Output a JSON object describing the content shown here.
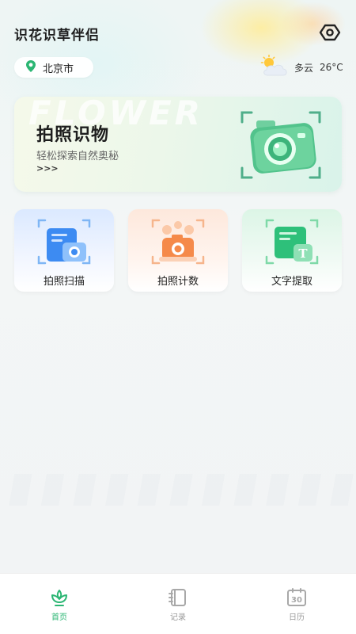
{
  "header": {
    "title": "识花识草伴侣",
    "settings_icon": "eye-icon"
  },
  "location": {
    "city": "北京市",
    "icon": "location-pin-icon",
    "icon_color": "#2bb673"
  },
  "weather": {
    "condition": "多云",
    "temperature": "26°C",
    "icon": "partly-cloudy-icon"
  },
  "banner": {
    "watermark": "FLOWER",
    "title": "拍照识物",
    "subtitle": "轻松探索自然奥秘",
    "arrows": ">>>",
    "icon": "camera-icon"
  },
  "tools": [
    {
      "label": "拍照扫描",
      "icon": "scan-document-icon",
      "color": "#3d8bf2"
    },
    {
      "label": "拍照计数",
      "icon": "count-camera-icon",
      "color": "#f58a4a"
    },
    {
      "label": "文字提取",
      "icon": "text-extract-icon",
      "color": "#2ec07a"
    }
  ],
  "tabbar": {
    "items": [
      {
        "label": "首页",
        "icon": "home-plant-icon",
        "active": true
      },
      {
        "label": "记录",
        "icon": "notebook-icon",
        "active": false
      },
      {
        "label": "日历",
        "icon": "calendar-icon",
        "active": false,
        "icon_text": "30"
      }
    ],
    "active_color": "#2bb673",
    "inactive_color": "#9a9a9a"
  }
}
